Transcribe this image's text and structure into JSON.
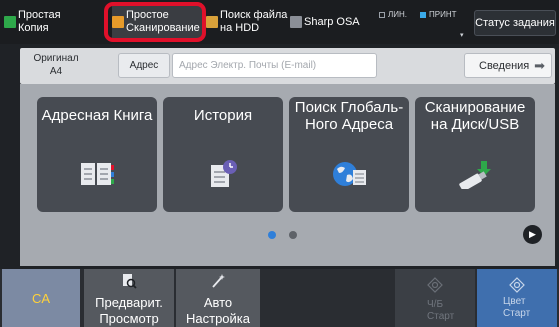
{
  "modes": {
    "copy": "Простая\nКопия",
    "scan": "Простое\nСканирование",
    "hdd": "Поиск файла\nна HDD",
    "osa": "Sharp OSA"
  },
  "indicators": {
    "line": "ЛИН.",
    "print": "ПРИНТ"
  },
  "job_status": "Статус задания",
  "original": {
    "label": "Оригинал",
    "size": "A4"
  },
  "address": {
    "button": "Адрес",
    "placeholder": "Адрес Электр. Почты (E-mail)",
    "details": "Сведения"
  },
  "shortcuts": [
    {
      "label": "Адресная Книга",
      "icon": "address-book-icon"
    },
    {
      "label": "История",
      "icon": "history-icon"
    },
    {
      "label": "Поиск Глобаль-\nНого Адреса",
      "icon": "global-address-search-icon"
    },
    {
      "label": "Сканирование\nна Диск/USB",
      "icon": "usb-scan-icon"
    }
  ],
  "pager": {
    "current": 1,
    "total": 2
  },
  "bottom": {
    "ca": "CA",
    "preview": "Предварит.\nПросмотр",
    "auto": "Авто\nНастройка",
    "bw_start": "Ч/Б\nСтарт",
    "color_start": "Цвет\nСтарт"
  },
  "colors": {
    "accent_blue": "#2f7fd9",
    "highlight_red": "#e0102a",
    "ca_text": "#ffd23a",
    "color_start_bg": "#3f6fae"
  }
}
